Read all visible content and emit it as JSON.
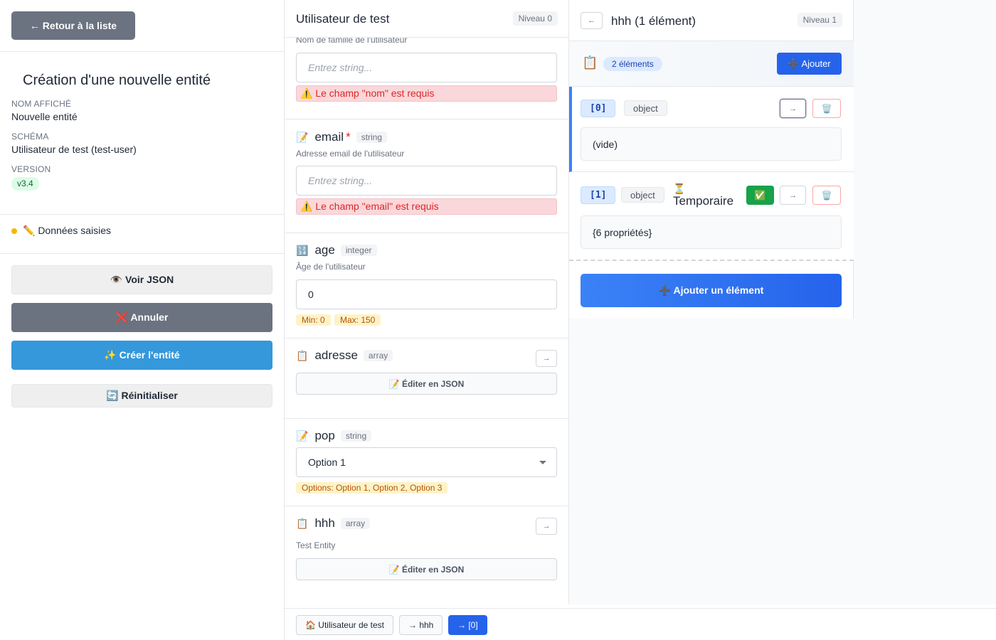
{
  "sidebar": {
    "back_label": "← Retour à la liste",
    "title": "Création d'une nouvelle entité",
    "display_name_label": "NOM AFFICHÉ",
    "display_name_value": "Nouvelle entité",
    "schema_label": "SCHÉMA",
    "schema_value": "Utilisateur de test (test-user)",
    "version_label": "VERSION",
    "version_value": "v3.4",
    "status_text": "✏️ Données saisies",
    "status_color": "#f5b800",
    "btn_view_json": "👁️ Voir JSON",
    "btn_cancel": "❌ Annuler",
    "btn_create": "✨ Créer l'entité",
    "btn_reset": "🔄 Réinitialiser"
  },
  "panel0": {
    "title": "Utilisateur de test",
    "level": "Niveau 0",
    "fields": {
      "nom": {
        "description": "Nom de famille de l'utilisateur",
        "placeholder": "Entrez string...",
        "error": "⚠️ Le champ \"nom\" est requis"
      },
      "email": {
        "icon": "📝",
        "name": "email",
        "required_mark": "*",
        "type": "string",
        "description": "Adresse email de l'utilisateur",
        "placeholder": "Entrez string...",
        "error": "⚠️ Le champ \"email\" est requis"
      },
      "age": {
        "icon": "🔢",
        "name": "age",
        "type": "integer",
        "description": "Âge de l'utilisateur",
        "value": "0",
        "min_hint": "Min: 0",
        "max_hint": "Max: 150"
      },
      "adresse": {
        "icon": "📋",
        "name": "adresse",
        "type": "array",
        "nav_label": "→",
        "edit_json": "📝 Éditer en JSON"
      },
      "pop": {
        "icon": "📝",
        "name": "pop",
        "type": "string",
        "selected": "Option 1",
        "options_hint": "Options: Option 1, Option 2, Option 3"
      },
      "hhh": {
        "icon": "📋",
        "name": "hhh",
        "type": "array",
        "nav_label": "→",
        "description": "Test Entity",
        "edit_json": "📝 Éditer en JSON"
      }
    }
  },
  "panel1": {
    "back_label": "←",
    "title": "hhh (1 élément)",
    "level": "Niveau 1",
    "list_icon": "📋",
    "count_badge": "2 éléments",
    "add_label": "➕ Ajouter",
    "items": [
      {
        "index": "[0]",
        "type": "object",
        "nav": "→",
        "delete": "🗑️",
        "body": "(vide)"
      },
      {
        "index": "[1]",
        "type": "object",
        "temp_icon": "⏳",
        "temp_label": "Temporaire",
        "confirm": "✅",
        "nav": "→",
        "delete": "🗑️",
        "body": "{6 propriétés}"
      }
    ],
    "add_item_label": "➕ Ajouter un élément"
  },
  "breadcrumb": [
    {
      "label": "🏠 Utilisateur de test"
    },
    {
      "label": "→ hhh"
    },
    {
      "label": "→ [0]"
    }
  ],
  "colors": {
    "primary": "#2563eb",
    "create": "#3498db",
    "secondary": "#6b7280",
    "error": "#dc2626",
    "success": "#16a34a"
  }
}
